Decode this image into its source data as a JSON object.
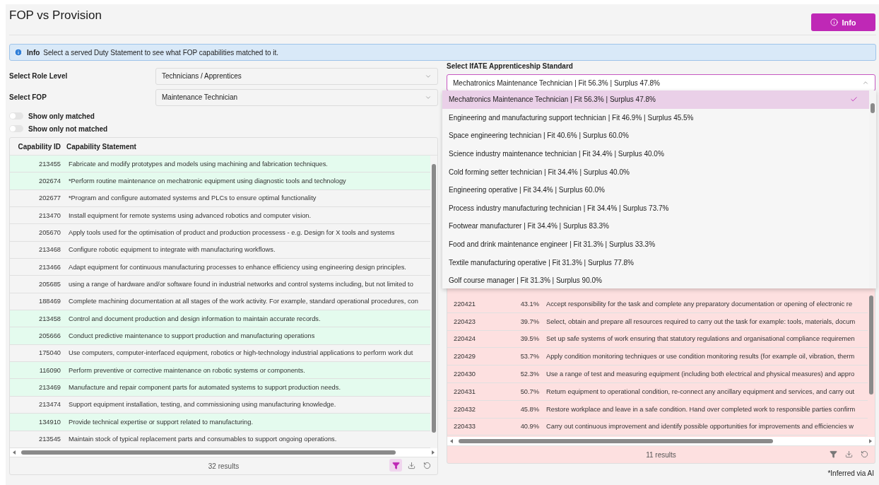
{
  "page": {
    "title": "FOP vs Provision",
    "info_button": "Info"
  },
  "alert": {
    "label": "Info",
    "text": "Select a served Duty Statement to see what FOP capabilities matched to it."
  },
  "filters": [
    {
      "label": "Select Role Level",
      "value": "Technicians / Apprentices"
    },
    {
      "label": "Select FOP",
      "value": "Maintenance Technician"
    }
  ],
  "toggles": [
    {
      "label": "Show only matched",
      "on": false
    },
    {
      "label": "Show only not matched",
      "on": false
    }
  ],
  "capability_table": {
    "columns": [
      "Capability ID",
      "Capability Statement"
    ],
    "rows": [
      {
        "id": "213455",
        "statement": "Fabricate and modify prototypes and models using machining and fabrication techniques.",
        "matched": true
      },
      {
        "id": "202674",
        "statement": "*Perform routine maintenance on mechatronic equipment using diagnostic tools and technology",
        "matched": true
      },
      {
        "id": "202677",
        "statement": "*Program and configure automated systems and PLCs to ensure optimal functionality",
        "matched": false
      },
      {
        "id": "213470",
        "statement": "Install equipment for remote systems using advanced robotics and computer vision.",
        "matched": false
      },
      {
        "id": "205670",
        "statement": "Apply tools used for the optimisation of product and production processess - e.g. Design for X tools and systems",
        "matched": false
      },
      {
        "id": "213468",
        "statement": "Configure robotic equipment to integrate with manufacturing workflows.",
        "matched": false
      },
      {
        "id": "213466",
        "statement": "Adapt equipment for continuous manufacturing processes to enhance efficiency using engineering design principles.",
        "matched": false
      },
      {
        "id": "205685",
        "statement": "using a range of hardware and/or software found in industrial networks and control systems including, but not limited to",
        "matched": false
      },
      {
        "id": "188469",
        "statement": "Complete machining documentation at all stages of the work activity. For example, standard operational procedures, con",
        "matched": false
      },
      {
        "id": "213458",
        "statement": "Control and document production and design information to maintain accurate records.",
        "matched": true
      },
      {
        "id": "205666",
        "statement": "Conduct predictive maintenance to support production and manufacturing operations",
        "matched": true
      },
      {
        "id": "175040",
        "statement": "Use computers, computer-interfaced equipment, robotics or high-technology industrial applications to perform work dut",
        "matched": false
      },
      {
        "id": "116090",
        "statement": "Perform preventive or corrective maintenance on robotic systems or components.",
        "matched": true
      },
      {
        "id": "213469",
        "statement": "Manufacture and repair component parts for automated systems to support production needs.",
        "matched": true
      },
      {
        "id": "213474",
        "statement": "Support equipment installation, testing, and commissioning using manufacturing knowledge.",
        "matched": false
      },
      {
        "id": "134910",
        "statement": "Provide technical expertise or support related to manufacturing.",
        "matched": true
      },
      {
        "id": "213545",
        "statement": "Maintain stock of typical replacement parts and consumables to support ongoing operations.",
        "matched": false
      }
    ],
    "results": "32 results",
    "filter_active": true
  },
  "standard_select": {
    "label": "Select IfATE Apprenticeship Standard",
    "value": "Mechatronics Maintenance Technician | Fit 56.3% | Surplus 47.8%",
    "options": [
      {
        "label": "Mechatronics Maintenance Technician | Fit 56.3% | Surplus 47.8%",
        "selected": true
      },
      {
        "label": "Engineering and manufacturing support technician | Fit 46.9% | Surplus 45.5%",
        "selected": false
      },
      {
        "label": "Space engineering technician | Fit 40.6% | Surplus 60.0%",
        "selected": false
      },
      {
        "label": "Science industry maintenance technician | Fit 34.4% | Surplus 40.0%",
        "selected": false
      },
      {
        "label": "Cold forming setter technician | Fit 34.4% | Surplus 40.0%",
        "selected": false
      },
      {
        "label": "Engineering operative | Fit 34.4% | Surplus 60.0%",
        "selected": false
      },
      {
        "label": "Process industry manufacturing technician | Fit 34.4% | Surplus 73.7%",
        "selected": false
      },
      {
        "label": "Footwear manufacturer | Fit 34.4% | Surplus 83.3%",
        "selected": false
      },
      {
        "label": "Food and drink maintenance engineer | Fit 31.3% | Surplus 33.3%",
        "selected": false
      },
      {
        "label": "Textile manufacturing operative | Fit 31.3% | Surplus 77.8%",
        "selected": false
      },
      {
        "label": "Golf course manager | Fit 31.3% | Surplus 90.0%",
        "selected": false
      }
    ]
  },
  "duty_table": {
    "rows": [
      {
        "id": "220421",
        "score": "43.1%",
        "statement": "Accept responsibility for the task and complete any preparatory documentation or opening of electronic re"
      },
      {
        "id": "220423",
        "score": "39.7%",
        "statement": "Select, obtain and prepare all resources required to carry out the task for example: tools, materials, docum"
      },
      {
        "id": "220424",
        "score": "39.5%",
        "statement": "Set up safe systems of work ensuring that statutory regulations and organisational compliance requiremen"
      },
      {
        "id": "220429",
        "score": "53.7%",
        "statement": "Apply condition monitoring techniques or use condition monitoring results (for example oil, vibration, therm"
      },
      {
        "id": "220430",
        "score": "52.3%",
        "statement": "Use a range of test and measuring equipment (including both electrical and physical measures) and appro"
      },
      {
        "id": "220431",
        "score": "50.7%",
        "statement": "Return equipment to operational condition, re-connect any ancillary equipment and services, and carry out"
      },
      {
        "id": "220432",
        "score": "45.8%",
        "statement": "Restore workplace and leave in a safe condition. Hand over completed work to responsible parties confirm"
      },
      {
        "id": "220433",
        "score": "40.9%",
        "statement": "Carry out continuous improvement and identify possible opportunities for improvements and efficiencies w"
      }
    ],
    "results": "11 results",
    "filter_active": false
  },
  "footnote": "*Inferred via AI"
}
